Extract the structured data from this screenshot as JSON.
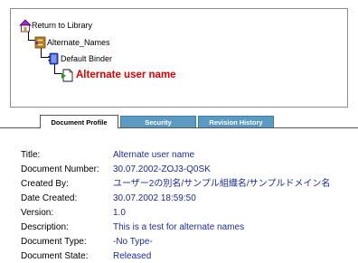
{
  "tree": {
    "library_label": "Return to Library",
    "folder_label": "Alternate_Names",
    "binder_label": "Default Binder",
    "current_item": "Alternate user name"
  },
  "tabs": [
    {
      "label": "Document Profile",
      "active": true
    },
    {
      "label": "Security",
      "active": false
    },
    {
      "label": "Revision History",
      "active": false
    }
  ],
  "properties": [
    {
      "label": "Title:",
      "value": "Alternate user name"
    },
    {
      "label": "Document Number:",
      "value": "30.07.2002-ZOJ3-Q0SK"
    },
    {
      "label": "Created By:",
      "value": "ユーザー2の別名/サンプル組織名/サンプルドメイン名"
    },
    {
      "label": "Date Created:",
      "value": "30.07.2002 18:59:50"
    },
    {
      "label": "Version:",
      "value": "1.0"
    },
    {
      "label": "Description:",
      "value": "This is a test for alternate names"
    },
    {
      "label": "Document Type:",
      "value": "-No Type-"
    },
    {
      "label": "Document State:",
      "value": "Released"
    }
  ],
  "colors": {
    "link": "#1d2c9a",
    "current_item": "#e00000",
    "tab_inactive": "#5b9bc3"
  },
  "icons": [
    "library-house-icon",
    "folder-cabinet-icon",
    "binder-icon",
    "document-icon"
  ]
}
